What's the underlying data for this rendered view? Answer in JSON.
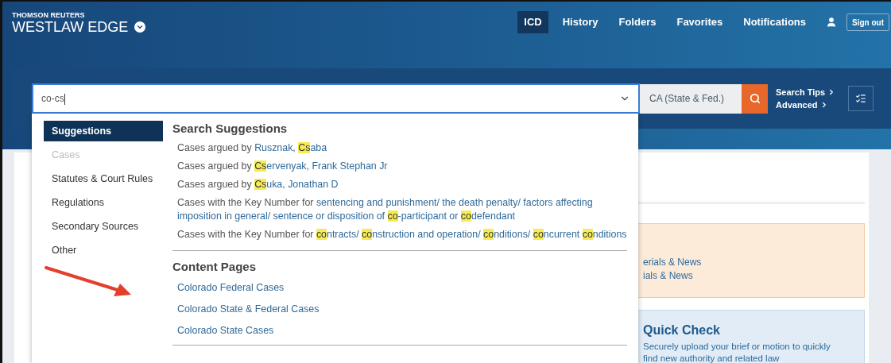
{
  "header": {
    "brand_top": "THOMSON REUTERS",
    "brand": "WESTLAW EDGE",
    "nav": [
      {
        "label": "ICD",
        "selected": true
      },
      {
        "label": "History",
        "selected": false
      },
      {
        "label": "Folders",
        "selected": false
      },
      {
        "label": "Favorites",
        "selected": false
      },
      {
        "label": "Notifications",
        "selected": false
      }
    ],
    "sign_out": "Sign out"
  },
  "search": {
    "value": "co-cs",
    "jurisdiction": "CA (State & Fed.)",
    "links": [
      "Search Tips",
      "Advanced"
    ]
  },
  "dropdown": {
    "categories": [
      {
        "label": "Suggestions",
        "selected": true,
        "disabled": false
      },
      {
        "label": "Cases",
        "selected": false,
        "disabled": true
      },
      {
        "label": "Statutes & Court Rules",
        "selected": false,
        "disabled": false
      },
      {
        "label": "Regulations",
        "selected": false,
        "disabled": false
      },
      {
        "label": "Secondary Sources",
        "selected": false,
        "disabled": false
      },
      {
        "label": "Other",
        "selected": false,
        "disabled": false
      }
    ],
    "sections": [
      {
        "title": "Search Suggestions",
        "items": [
          {
            "prefix": "Cases argued by ",
            "link": "Rusznak, **Cs**aba"
          },
          {
            "prefix": "Cases argued by ",
            "link": "**Cs**ervenyak, Frank Stephan Jr"
          },
          {
            "prefix": "Cases argued by ",
            "link": "**Cs**uka, Jonathan D"
          },
          {
            "prefix": "Cases with the Key Number for ",
            "link": "sentencing and punishment/ the death penalty/ factors affecting imposition in general/ sentence or disposition of **co**-participant or **co**defendant"
          },
          {
            "prefix": "Cases with the Key Number for ",
            "link": "**co**ntracts/ **co**nstruction and operation/ **co**nditions/ **co**ncurrent **co**nditions"
          }
        ]
      },
      {
        "title": "Content Pages",
        "items": [
          {
            "link": "Colorado Federal Cases"
          },
          {
            "link": "Colorado State & Federal Cases"
          },
          {
            "link": "Colorado State Cases"
          }
        ]
      }
    ]
  },
  "background": {
    "promo_lines": [
      "erials & News",
      "ials & News"
    ],
    "quick_check": {
      "title": "Quick Check",
      "text": "Securely upload your brief or motion to quickly find new authority and related law"
    }
  }
}
